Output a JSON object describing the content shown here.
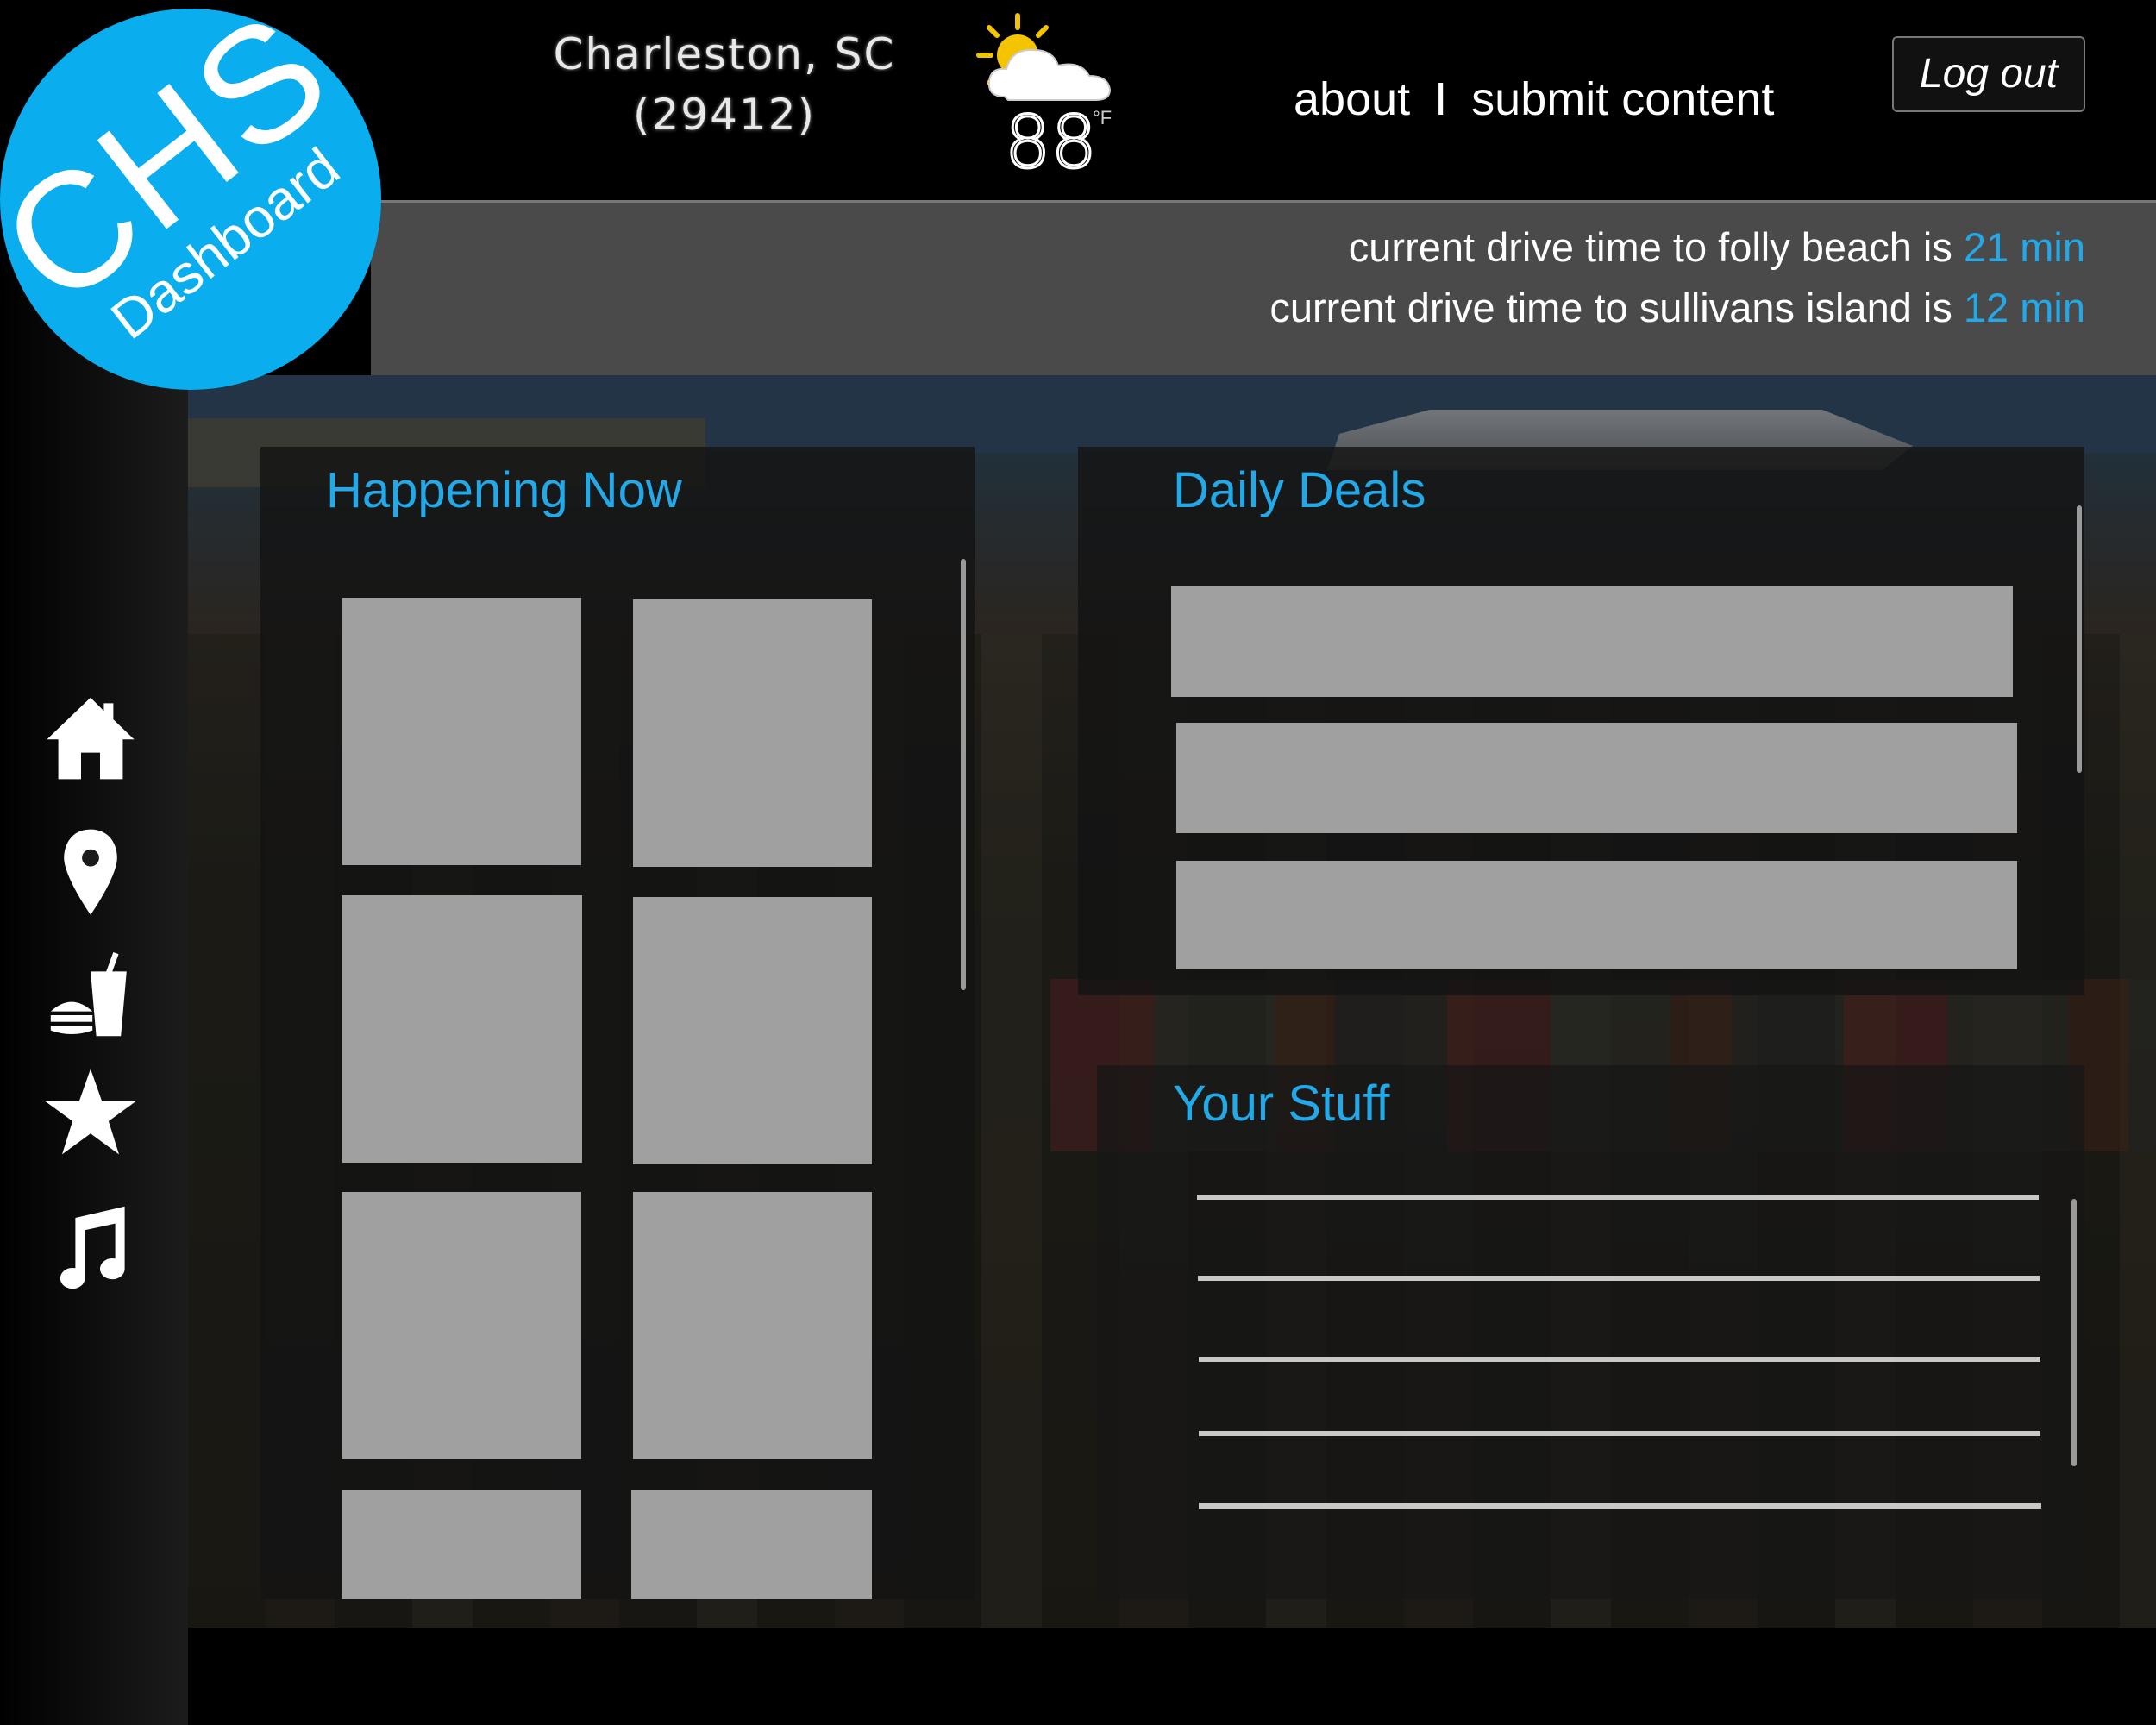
{
  "logo": {
    "main": "CHS",
    "sub": "Dashboard"
  },
  "header": {
    "location_city": "Charleston, SC",
    "location_zip": "(29412)",
    "weather": {
      "icon": "partly-cloudy-icon",
      "temperature": "88",
      "unit": "°F"
    },
    "nav": {
      "about": "about",
      "separator": "I",
      "submit": "submit content"
    },
    "logout_label": "Log out"
  },
  "drive_times": [
    {
      "text": "current drive time to folly beach is",
      "value": "21 min"
    },
    {
      "text": "current drive time to sullivans island is",
      "value": "12 min"
    }
  ],
  "sidebar": {
    "items": [
      {
        "icon": "home-icon"
      },
      {
        "icon": "map-pin-icon"
      },
      {
        "icon": "food-drink-icon"
      },
      {
        "icon": "star-icon"
      },
      {
        "icon": "music-note-icon"
      }
    ]
  },
  "panels": {
    "happening_now": {
      "title": "Happening Now"
    },
    "daily_deals": {
      "title": "Daily Deals"
    },
    "your_stuff": {
      "title": "Your Stuff"
    }
  },
  "colors": {
    "accent": "#23a8e8",
    "logo": "#0aaeee",
    "placeholder": "#a0a0a0"
  }
}
